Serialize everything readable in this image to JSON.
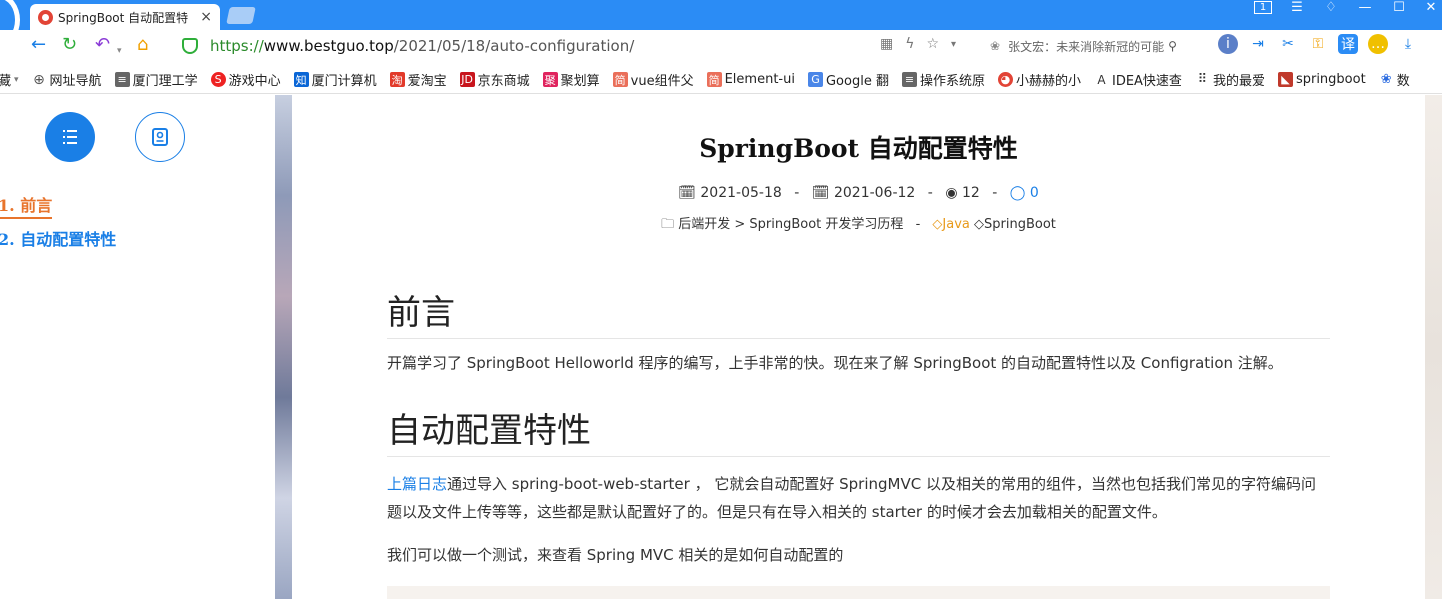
{
  "browser": {
    "tab_title": "SpringBoot 自动配置特",
    "tab_close": "×",
    "window_counter": "1",
    "url": {
      "scheme": "https://",
      "domain": "www.bestguo.top",
      "path": "/2021/05/18/auto-configuration/"
    },
    "search_text": "张文宏：未来消除新冠的可能",
    "bookmarks": [
      {
        "label": "藏",
        "icon": "folder-icon"
      },
      {
        "label": "网址导航",
        "icon": "globe-icon"
      },
      {
        "label": "厦门理工学",
        "icon": "document-icon"
      },
      {
        "label": "游戏中心",
        "icon": "game-icon"
      },
      {
        "label": "厦门计算机",
        "icon": "zhihu-icon"
      },
      {
        "label": "爱淘宝",
        "icon": "taobao-icon"
      },
      {
        "label": "京东商城",
        "icon": "jd-icon"
      },
      {
        "label": "聚划算",
        "icon": "juhuasuan-icon"
      },
      {
        "label": "vue组件父",
        "icon": "jianshu-icon"
      },
      {
        "label": "Element-ui",
        "icon": "jianshu-icon"
      },
      {
        "label": "Google 翻",
        "icon": "translate-icon"
      },
      {
        "label": "操作系统原",
        "icon": "document-icon"
      },
      {
        "label": "小赫赫的小",
        "icon": "avatar-icon"
      },
      {
        "label": "IDEA快速查",
        "icon": "idea-icon"
      },
      {
        "label": "我的最爱",
        "icon": "grid-icon"
      },
      {
        "label": "springboot",
        "icon": "springboot-icon"
      },
      {
        "label": "数",
        "icon": "paw-icon"
      }
    ]
  },
  "sidebar": {
    "toc": [
      {
        "label": "1. 前言"
      },
      {
        "label": "2. 自动配置特性"
      }
    ]
  },
  "post": {
    "title": "SpringBoot 自动配置特性",
    "created": "2021-05-18",
    "updated": "2021-06-12",
    "views": "12",
    "comments": "0",
    "separator": "-",
    "category_path": "后端开发 > SpringBoot 开发学习历程",
    "tags": [
      "Java",
      "SpringBoot"
    ],
    "sections": [
      {
        "heading": "前言",
        "paragraph": "开篇学习了 SpringBoot Helloworld 程序的编写，上手非常的快。现在来了解 SpringBoot 的自动配置特性以及 Configration 注解。"
      },
      {
        "heading": "自动配置特性",
        "link_text": "上篇日志",
        "paragraph": "通过导入 spring-boot-web-starter ， 它就会自动配置好 SpringMVC 以及相关的常用的组件，当然也包括我们常见的字符编码问题以及文件上传等等，这些都是默认配置好了的。但是只有在导入相关的 starter 的时候才会去加载相关的配置文件。",
        "paragraph2": "我们可以做一个测试，来查看 Spring MVC 相关的是如何自动配置的"
      }
    ]
  },
  "colors": {
    "accent": "#1a7fe6",
    "active_toc": "#e8742c",
    "tabbar": "#2b8cf5"
  }
}
